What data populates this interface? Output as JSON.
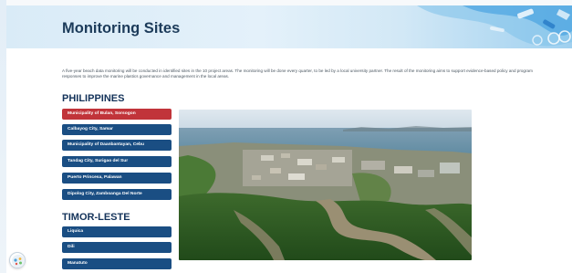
{
  "header": {
    "title": "Monitoring Sites"
  },
  "intro": {
    "text": "A five-year beach data monitoring will be conducted in identified sites in the 10 project areas. The monitoring will be done every quarter, to be led by a local university partner. The result of the monitoring aims to support evidence-based policy and program responses to improve the marine plastics governance and management in the local areas."
  },
  "sections": [
    {
      "heading": "PHILIPPINES",
      "sites": [
        {
          "label": "Municipality of Bulan, Sorsogon",
          "active": true
        },
        {
          "label": "Calbayog City, Samar",
          "active": false
        },
        {
          "label": "Municipality of Daanbantayan, Cebu",
          "active": false
        },
        {
          "label": "Tandag City, Surigao del Sur",
          "active": false
        },
        {
          "label": "Puerto Princesa, Palawan",
          "active": false
        },
        {
          "label": "Dipolog City, Zamboanga Del Norte",
          "active": false
        }
      ]
    },
    {
      "heading": "TIMOR-LESTE",
      "sites": [
        {
          "label": "Liquica",
          "active": false
        },
        {
          "label": "Dili",
          "active": false
        },
        {
          "label": "Manatuto",
          "active": false
        }
      ]
    }
  ],
  "colors": {
    "button": "#1a4e83",
    "button_active": "#c1343a",
    "heading": "#14335a",
    "title": "#1c3b5a"
  },
  "icons": {
    "chat": "chat-widget-icon"
  }
}
